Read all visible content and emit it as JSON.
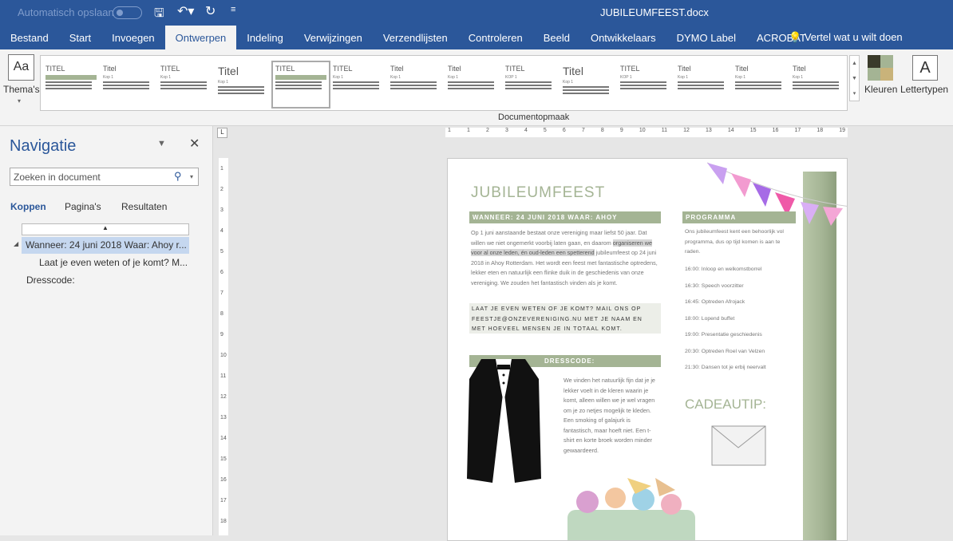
{
  "titlebar": {
    "autosave": "Automatisch opslaan",
    "filename": "JUBILEUMFEEST.docx",
    "icons": [
      "save-icon",
      "undo-icon",
      "redo-icon",
      "customize-icon"
    ]
  },
  "tabs": [
    "Bestand",
    "Start",
    "Invoegen",
    "Ontwerpen",
    "Indeling",
    "Verwijzingen",
    "Verzendlijsten",
    "Controleren",
    "Beeld",
    "Ontwikkelaars",
    "DYMO Label",
    "ACROBAT"
  ],
  "active_tab": "Ontwerpen",
  "tell_me": "Vertel wat u wilt doen",
  "ribbon": {
    "themes": "Thema's",
    "colors": "Kleuren",
    "fonts": "Lettertypen",
    "group_label": "Documentopmaak",
    "styles": [
      {
        "t": "TITEL",
        "k": ""
      },
      {
        "t": "Titel",
        "k": "Kop 1"
      },
      {
        "t": "TITEL",
        "k": "Kop 1"
      },
      {
        "t": "Titel",
        "k": "Kop 1"
      },
      {
        "t": "TITEL",
        "k": ""
      },
      {
        "t": "TITEL",
        "k": "Kop 1"
      },
      {
        "t": "Titel",
        "k": "Kop 1"
      },
      {
        "t": "Titel",
        "k": "Kop 1"
      },
      {
        "t": "TITEL",
        "k": "KOP 1"
      },
      {
        "t": "Titel",
        "k": "Kop 1"
      },
      {
        "t": "TITEL",
        "k": "KOP 1"
      },
      {
        "t": "Titel",
        "k": "Kop 1"
      },
      {
        "t": "Titel",
        "k": "Kop 1"
      },
      {
        "t": "Titel",
        "k": "Kop 1"
      }
    ]
  },
  "nav": {
    "title": "Navigatie",
    "search_placeholder": "Zoeken in document",
    "tabs": [
      "Koppen",
      "Pagina's",
      "Resultaten"
    ],
    "active_tab": "Koppen",
    "headings": [
      "Wanneer: 24 juni 2018 Waar: Ahoy r...",
      "Laat je even weten of je komt? M...",
      "Dresscode:"
    ]
  },
  "ruler": {
    "h": [
      "1",
      "1",
      "2",
      "3",
      "4",
      "5",
      "6",
      "7",
      "8",
      "9",
      "10",
      "11",
      "12",
      "13",
      "14",
      "15",
      "16",
      "17",
      "18",
      "19"
    ],
    "v": [
      "1",
      "2",
      "3",
      "4",
      "5",
      "6",
      "7",
      "8",
      "9",
      "10",
      "11",
      "12",
      "13",
      "14",
      "15",
      "16",
      "17",
      "18"
    ]
  },
  "doc": {
    "title": "JUBILEUMFEEST",
    "when": "WANNEER: 24 JUNI 2018 WAAR: AHOY ROTTERDAM",
    "intro_1": "Op 1 juni aanstaande bestaat onze vereniging maar liefst 50 jaar. Dat willen we niet ongemerkt voorbij laten gaan, en daarom",
    "intro_highlight": "organiseren we voor al onze leden, én oud-leden een spetterend",
    "intro_2": "jubileumfeest op 24 juni 2018 in Ahoy Rotterdam. Het wordt een feest met fantastische optredens, lekker eten en natuurlijk een flinke duik in de geschiedenis van onze vereniging. We zouden het fantastisch vinden als je komt.",
    "rsvp": "LAAT JE EVEN WETEN OF JE KOMT? MAIL ONS OP FEESTJE@ONZEVERENIGING.NU MET JE NAAM EN MET HOEVEEL MENSEN JE IN TOTAAL KOMT.",
    "dresscode_title": "DRESSCODE:",
    "dresscode": "We vinden het natuurlijk fijn dat je je lekker voelt in de kleren waarin je komt, alleen willen we je wel vragen om je zo netjes mogelijk te kleden. Een smoking of galajurk is fantastisch, maar hoeft niet. Een t-shirt en korte broek worden minder gewaardeerd.",
    "programma_title": "PROGRAMMA",
    "programma_intro": "Ons jubileumfeest  kent een behoorlijk vol programma,  dus op tijd komen  is aan te raden.",
    "programma": [
      "16:00:  Inloop en welkomstborrel",
      "16:30:  Speech voorzitter",
      "16:45:  Optreden  Afrojack",
      "18:00:  Lopend  buffet",
      "19:00:  Presentatie geschiedenis",
      "20:30:  Optreden  Roel van Velzen",
      "21:30:  Dansen tot je erbij neervalt"
    ],
    "cadeau": "CADEAUTIP:"
  },
  "colors": {
    "word_blue": "#2b579a",
    "sage": "#a4b494",
    "title_green": "#a4b494",
    "bunting": [
      "#c9a0f0",
      "#f29bd0",
      "#a66be6",
      "#ef5aa8",
      "#d9aef5",
      "#f4a6d6"
    ]
  }
}
